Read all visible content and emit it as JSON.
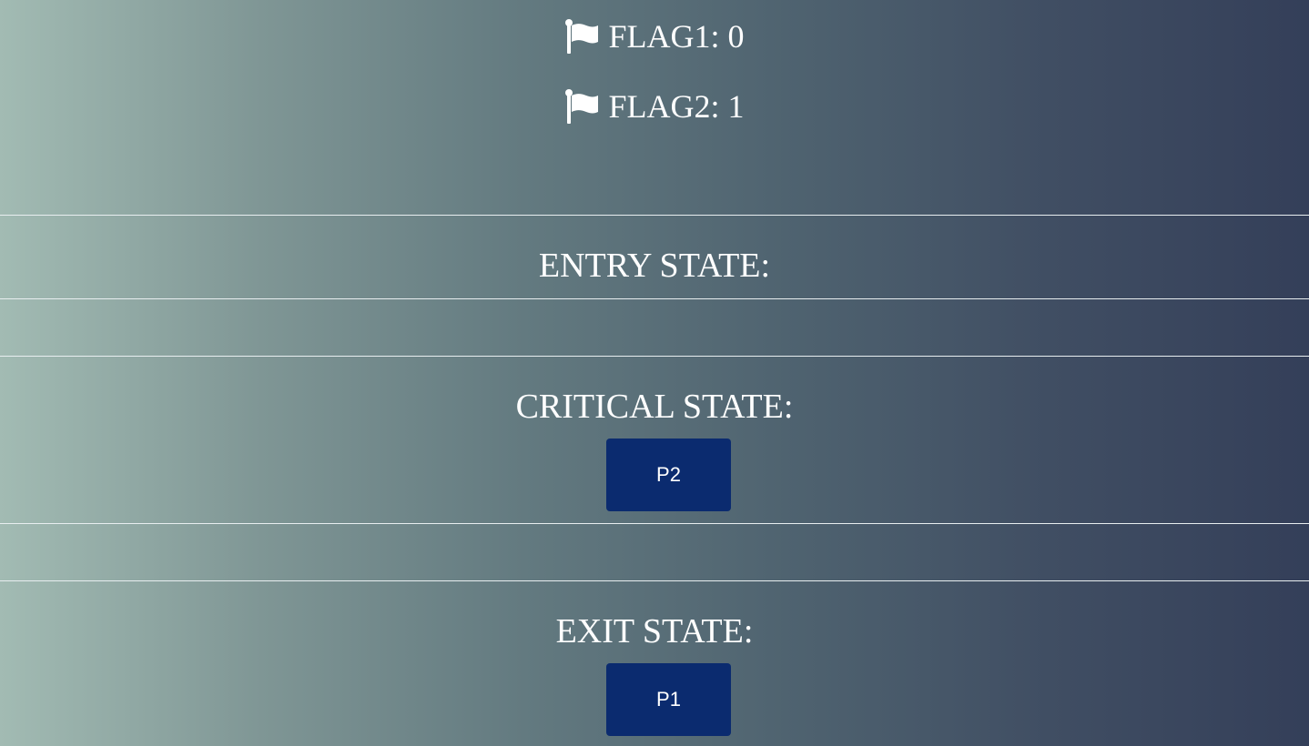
{
  "flags": [
    {
      "icon": "flag-icon",
      "label": "FLAG1",
      "value": "0"
    },
    {
      "icon": "flag-icon",
      "label": "FLAG2",
      "value": "1"
    }
  ],
  "states": {
    "entry": {
      "heading": "ENTRY STATE:",
      "process": ""
    },
    "critical": {
      "heading": "CRITICAL STATE:",
      "process": "P2"
    },
    "exit": {
      "heading": "EXIT STATE:",
      "process": "P1"
    }
  },
  "colors": {
    "gradient_left": "#a2bbb3",
    "gradient_right": "#343f59",
    "button_bg": "#0b2b6f",
    "text": "#ffffff",
    "divider": "#e8eef0"
  }
}
